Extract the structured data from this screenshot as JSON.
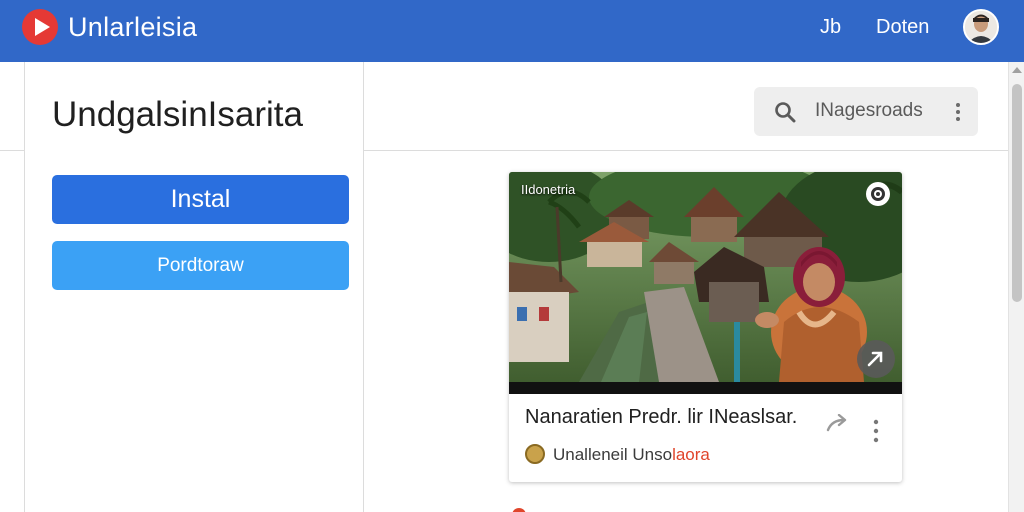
{
  "header": {
    "app_title": "Unlarleisia",
    "nav": [
      "Jb",
      "Doten"
    ],
    "accent": "#3168c8"
  },
  "sidebar": {
    "heading": "UndgalsinIsarita",
    "primary_button": "Instal",
    "secondary_button": "Pordtoraw"
  },
  "search": {
    "value": "INagesroads",
    "icon": "search-icon"
  },
  "video": {
    "thumb_label": "IIdonetria",
    "title": "Nanaratien Predr. lir INeaslsar.",
    "channel_part1": "Unalleneil Unso",
    "channel_part2": "laora",
    "actions": [
      "share-icon",
      "more-vert-icon"
    ]
  },
  "colors": {
    "primary_button": "#2a6fdf",
    "secondary_button": "#3ba1f5",
    "channel_highlight": "#e0452b"
  }
}
